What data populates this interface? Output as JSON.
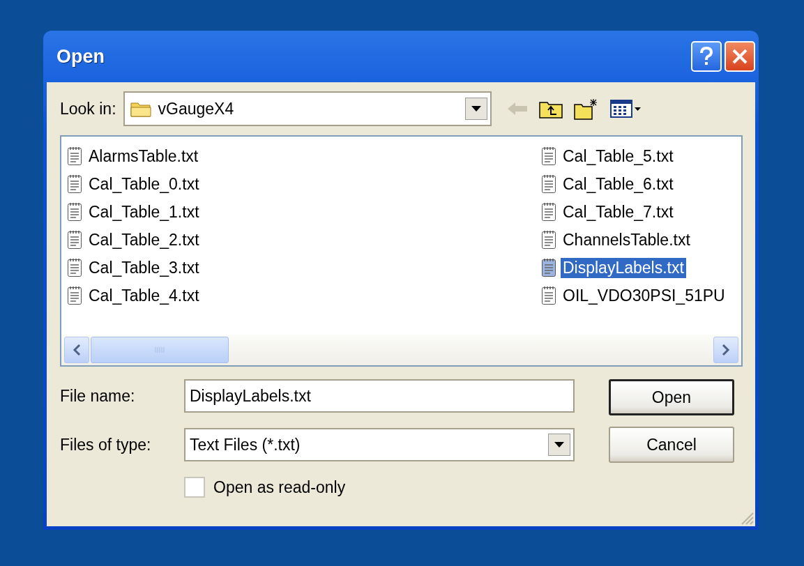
{
  "window": {
    "title": "Open"
  },
  "look_in": {
    "label": "Look in:",
    "value": "vGaugeX4"
  },
  "files": [
    {
      "name": "AlarmsTable.txt",
      "selected": false
    },
    {
      "name": "Cal_Table_0.txt",
      "selected": false
    },
    {
      "name": "Cal_Table_1.txt",
      "selected": false
    },
    {
      "name": "Cal_Table_2.txt",
      "selected": false
    },
    {
      "name": "Cal_Table_3.txt",
      "selected": false
    },
    {
      "name": "Cal_Table_4.txt",
      "selected": false
    },
    {
      "name": "Cal_Table_5.txt",
      "selected": false
    },
    {
      "name": "Cal_Table_6.txt",
      "selected": false
    },
    {
      "name": "Cal_Table_7.txt",
      "selected": false
    },
    {
      "name": "ChannelsTable.txt",
      "selected": false
    },
    {
      "name": "DisplayLabels.txt",
      "selected": true
    },
    {
      "name": "OIL_VDO30PSI_51PU",
      "selected": false
    }
  ],
  "file_name": {
    "label": "File name:",
    "value": "DisplayLabels.txt"
  },
  "file_type": {
    "label": "Files of type:",
    "value": "Text Files (*.txt)"
  },
  "read_only": {
    "label": "Open as read-only",
    "checked": false
  },
  "buttons": [
    {
      "label": "Open",
      "default": true
    },
    {
      "label": "Cancel",
      "default": false
    }
  ]
}
